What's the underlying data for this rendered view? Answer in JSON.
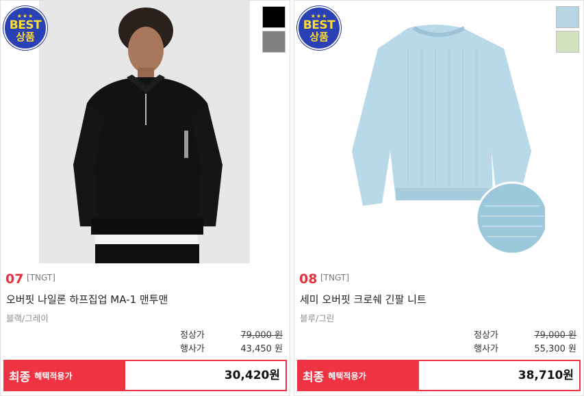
{
  "products": [
    {
      "badge": {
        "stars": "★★★",
        "top": "BEST",
        "bottom": "상품"
      },
      "swatches": [
        {
          "color": "#000000",
          "label": "black"
        },
        {
          "color": "#808080",
          "label": "gray"
        }
      ],
      "rank": "07",
      "brand": "[TNGT]",
      "name": "오버핏 나일론 하프집업 MA-1 맨투맨",
      "color_options": "블랙/그레이",
      "regular_label": "정상가",
      "regular_price": "79,000 원",
      "sale_label": "행사가",
      "sale_price": "43,450 원",
      "final_label": "최종",
      "final_sub": "혜택적용가",
      "final_price": "30,420원"
    },
    {
      "badge": {
        "stars": "★★★",
        "top": "BEST",
        "bottom": "상품"
      },
      "swatches": [
        {
          "color": "#b6d4e2",
          "label": "blue"
        },
        {
          "color": "#d3e3bf",
          "label": "green"
        }
      ],
      "rank": "08",
      "brand": "[TNGT]",
      "name": "세미 오버핏 크로쉐 긴팔 니트",
      "color_options": "블루/그린",
      "regular_label": "정상가",
      "regular_price": "79,000 원",
      "sale_label": "행사가",
      "sale_price": "55,300 원",
      "final_label": "최종",
      "final_sub": "혜택적용가",
      "final_price": "38,710원"
    }
  ]
}
